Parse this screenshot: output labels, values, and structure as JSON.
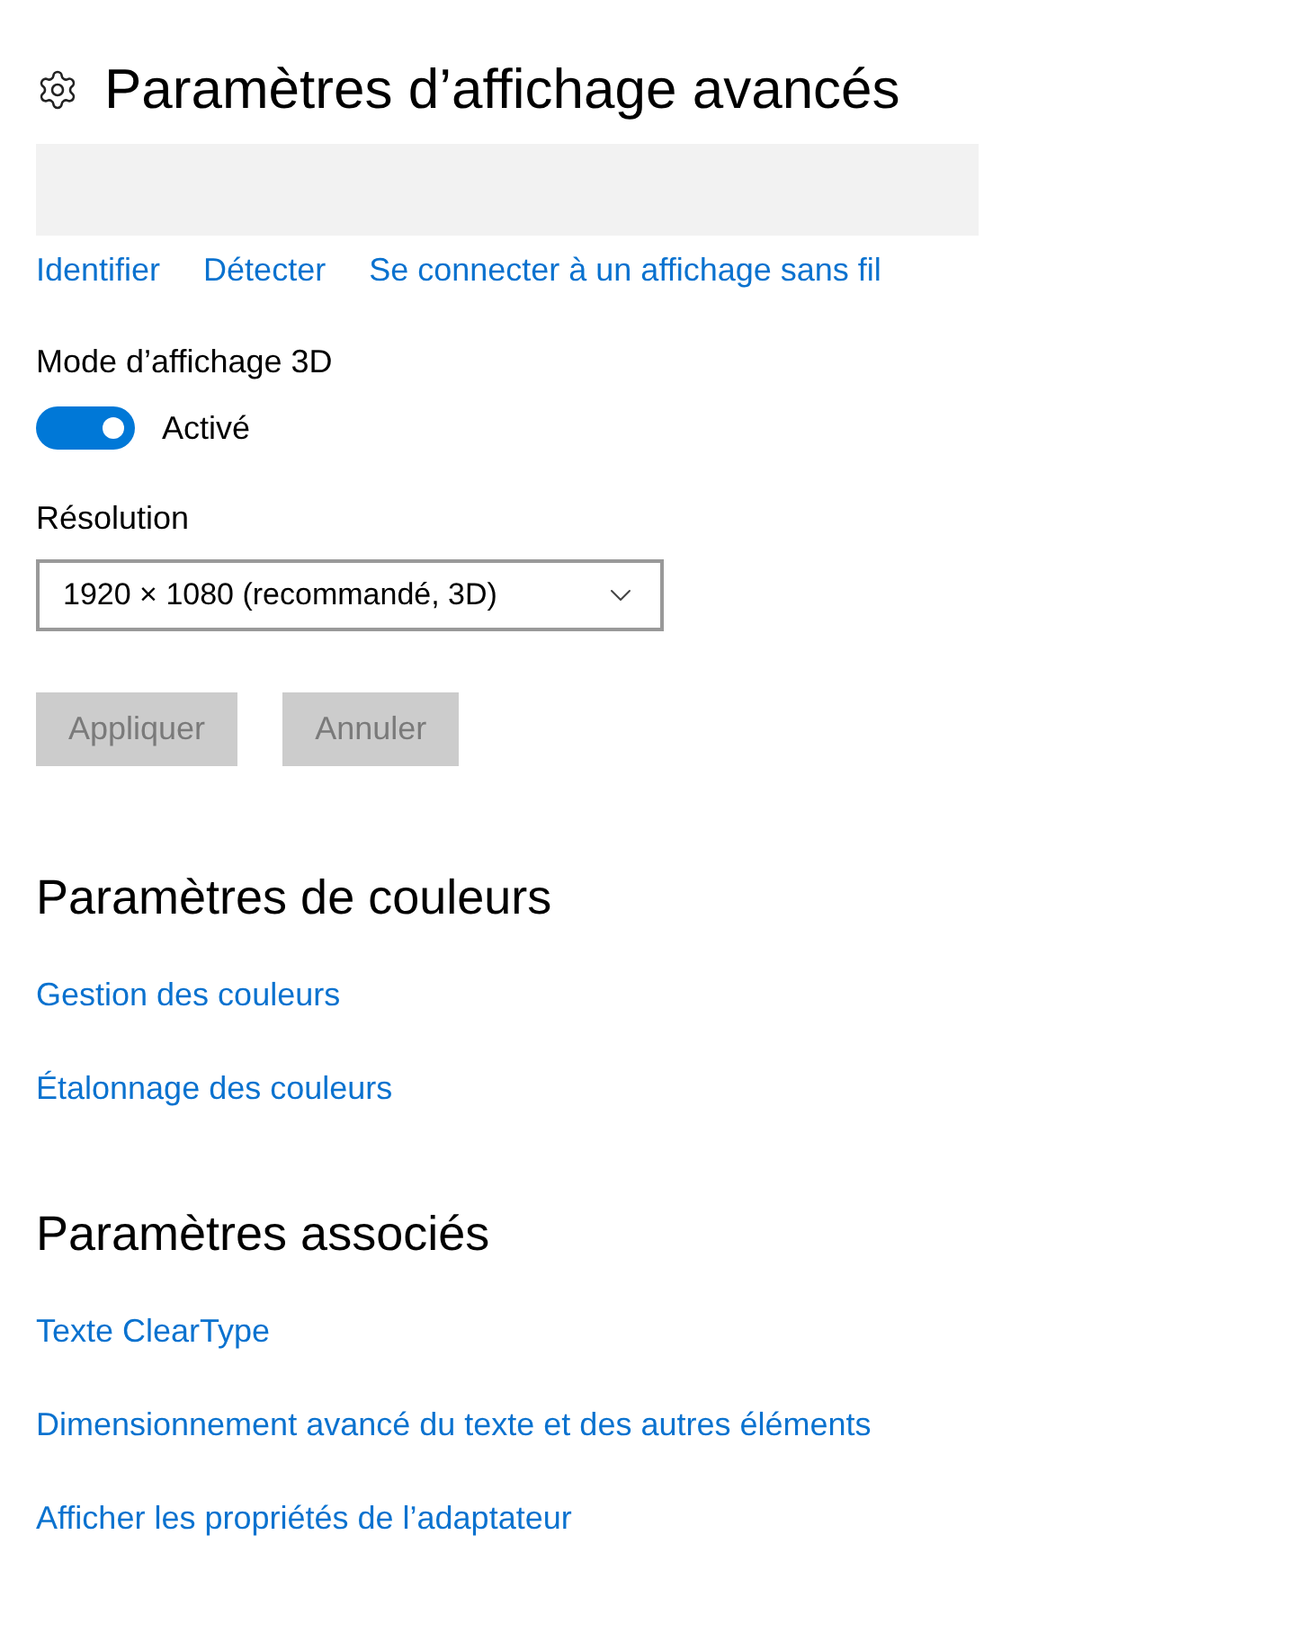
{
  "header": {
    "title": "Paramètres d’affichage avancés"
  },
  "display_links": [
    "Identifier",
    "Détecter",
    "Se connecter à un affichage sans fil"
  ],
  "mode_3d": {
    "label": "Mode d’affichage 3D",
    "on": true,
    "state_label": "Activé"
  },
  "resolution": {
    "label": "Résolution",
    "value": "1920 × 1080 (recommandé, 3D)"
  },
  "buttons": [
    {
      "label": "Appliquer",
      "disabled": true
    },
    {
      "label": "Annuler",
      "disabled": true
    }
  ],
  "sections": [
    {
      "title": "Paramètres de couleurs",
      "links": [
        "Gestion des couleurs",
        "Étalonnage des couleurs"
      ]
    },
    {
      "title": "Paramètres associés",
      "links": [
        "Texte ClearType",
        "Dimensionnement avancé du texte et des autres éléments",
        "Afficher les propriétés de l’adaptateur"
      ]
    }
  ]
}
